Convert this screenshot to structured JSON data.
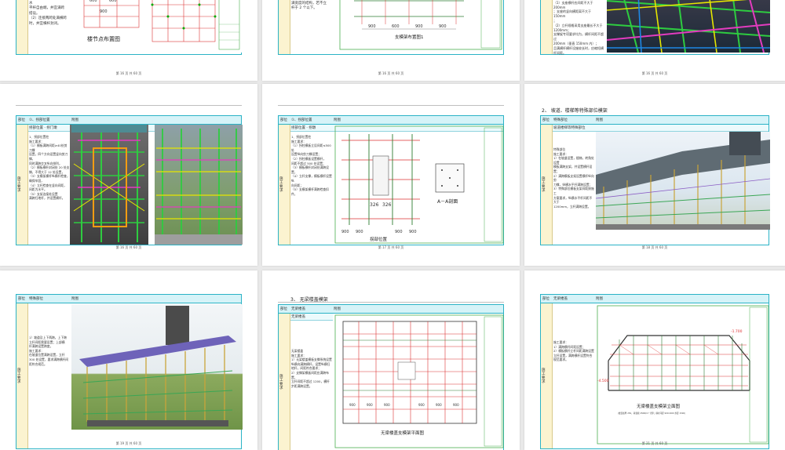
{
  "pages": {
    "p1": {
      "text": "（1）连续两跨设置纵横向水\n平杆自由端，并宜满跨\n搭设。\n（2）连接两跨处满横跨\n时，并宜横杆封闭。",
      "figure_title": "楼节点布置图",
      "dims": [
        "600",
        "600",
        "900"
      ],
      "footer": "第 16 页 共 60 页"
    },
    "p2": {
      "text": "（1）满宽度的上立杆\n满宽度的结构，若不立\n杆于 2 个以下。",
      "figure_title": "支模架布置图1",
      "dims": [
        "470",
        "430",
        "900",
        "600",
        "900",
        "900"
      ],
      "footer": "第 16 页 共 60 页"
    },
    "p3": {
      "text": "施工要求：\n（1）支座横杆应间距不大于 200mm\n；支座的竖向横距离不大于 150mm\n；\n（2）立杆规格采用支座最长不大于\n1200mm；\n支撑架专项要求均为，横杆间距不超过\n200mm（垂直 150mm 内）；\n且满横杆横杆设施较长时，应缩短横\n杆间距。",
      "footer": "第 16 页 共 60 页"
    },
    "p4": {
      "col1": "部位",
      "col2": "①、拐部位置",
      "col3": "附图",
      "sub": "拐部位置 · 拐门墩",
      "left": "施\n工\n要\n求",
      "text": "1、拐部位置柱\n施工要求：\n（1）模板满跨间距≥40处剪刀撑\n设置，四个方向设置竖向剪刀撑，\n同时满跨交叉纵向排列，\n（2）模板横杆封闭处 20 处支\n撑，不得大于 12 处设置，\n（3）支模架横杆纵横杆检查，\n确保牢固，\n（4）立杆检查在竖向间距，\n间距为水平。\n（5）支架连接处设置\n满跨扫地杆，并设置横杆。",
      "footer": "第 16 页 共 60 页"
    },
    "p5": {
      "col1": "部位",
      "col2": "①、拐部位置",
      "col3": "附图",
      "sub": "拐部位置 · 拐墩",
      "left": "施\n工\n要\n求",
      "text": "1、拐部位置柱\n施工要求：\n（1）拐柱模板立设间距≤500处\n设置纵向剪刀撑设置；\n（2）拐柱模板设置横杆，\n间距不超过 500 处设置；\n（3）模板横杆封闭处满跨设置，\n（4）立杆支撑，模板横杆设置纵\n向间距；\n（5）支模架横杆满跨检查扣件。",
      "figure_title": "拐部位置",
      "section_title": "A－A剖面",
      "dims": [
        "900",
        "900",
        "326",
        "326",
        "900",
        "900"
      ],
      "footer": "第 17 页 共 60 页"
    },
    "p6": {
      "heading": "2、  坡道、楼梯等特殊部位模架",
      "col1": "部位",
      "col2": "特殊部位",
      "col3": "附图",
      "sub": "坡道楼梯等特殊部位",
      "left": "施\n工\n要\n求",
      "text": "特殊部位\n施工要求：\n1）在坡道设置，楼梯，转角处设置\n模板满跨支架，并设置横杆设\n置；\n2）满跨模板支架设置横杆纵向剪\n刀撑，纵横水平杆满跨设置；\n3）特殊部位模板支架间距按施工\n方案要求，纵横水平杆间距不大于\n1200mm，立杆满跨设置。",
      "footer": "第 18 页 共 60 页"
    },
    "p7": {
      "col1": "部位",
      "col2": "特殊部位",
      "col3": "附图",
      "left": "施\n工\n要\n求",
      "text": "1）坡道及上下两跨，上下跨\n立杆间距需要设置；上部横\n杆满跨设置跨度，\n施工要求：\n在坡道位置满跨设置，立杆\n300 处设置，要求满跨横杆间\n距符合规范。",
      "footer": "第 19 页 共 60 页"
    },
    "p8": {
      "heading": "3、  无梁楼盖模架",
      "col1": "部位",
      "col2": "无梁楼盖",
      "col3": "附图",
      "sub": "无梁楼盖",
      "left": "施\n工\n要\n求",
      "text": "无梁楼盖\n施工要求：\n1）无梁楼盖模板支撑系统设置\n纵横向满跨横杆，设置纵横扫\n地杆，间距符合要求；\n2）支撑架模板间距应满跨布置，\n立杆间距不超过 1200，横杆\n步距满跨设置。",
      "figure_title": "无梁楼盖支模架平面图",
      "dims": [
        "900",
        "900",
        "900",
        "900",
        "900",
        "900"
      ],
      "footer": "第 20 页 共 60 页"
    },
    "p9": {
      "col1": "部位",
      "col2": "无梁楼盖",
      "col3": "附图",
      "left": "施\n工\n要\n求",
      "text": "施工要求：\n1）满跨横杆间距设置；\n2）模板横杆立杆间距满跨设置\n立杆设置，满跨横杆设置符合\n规范要求。",
      "figure_title": "无梁楼盖支模架立面图",
      "figure_sub": "(楼盖板厚 250，荷载按 25KN/m³ 计算；横杆间距 900×900 步距 1500)",
      "elev_left": "-4.500",
      "elev_right": "-1.700",
      "footer": "第 21 页 共 60 页"
    }
  }
}
